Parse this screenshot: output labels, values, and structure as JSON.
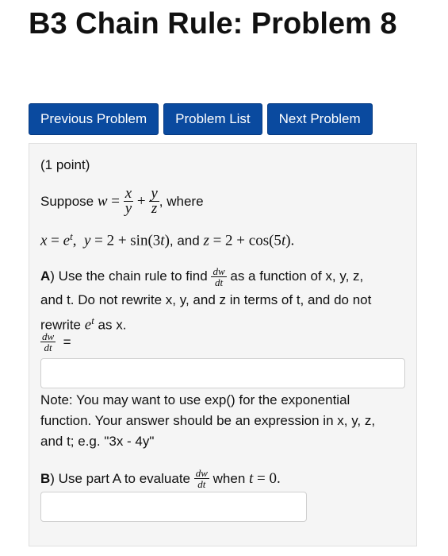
{
  "page": {
    "title": "B3 Chain Rule: Problem 8"
  },
  "nav": {
    "previous": "Previous Problem",
    "list": "Problem List",
    "next": "Next Problem"
  },
  "problem": {
    "points": "(1 point)",
    "suppose_prefix": "Suppose",
    "where": ", where",
    "and_word": ", and",
    "part_a_letter": "A",
    "part_a_text_1": ") Use the chain rule to find",
    "part_a_text_2": "as a function of x, y, z,",
    "part_a_line2": "and t. Do not rewrite x, y, and z in terms of t, and do not",
    "part_a_line3_prefix": "rewrite",
    "part_a_line3_suffix": "as x.",
    "equals": "=",
    "answer_a_value": "",
    "note_line1": "Note: You may want to use exp() for the exponential",
    "note_line2": "function. Your answer should be an expression in x, y, z,",
    "note_line3": "and t; e.g. \"3x - 4y\"",
    "part_b_letter": "B",
    "part_b_text": ") Use part A to evaluate",
    "part_b_when": "when",
    "answer_b_value": ""
  }
}
